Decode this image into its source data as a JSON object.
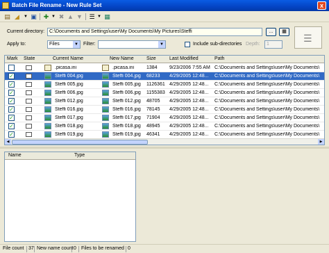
{
  "window": {
    "title": "Batch File Rename - New Rule Set",
    "close_label": "x"
  },
  "toolbar": {
    "icons": [
      "new-icon",
      "open-icon",
      "save-icon",
      "add-icon",
      "delete-icon",
      "up-icon",
      "down-icon",
      "view-icon",
      "copy-icon"
    ]
  },
  "top": {
    "dir_label": "Current directory:",
    "dir_value": "C:\\Documents and Settings\\user\\My Documents\\My Pictures\\Steffi",
    "browse_label": "...",
    "apply_label": "Apply to:",
    "apply_value": "Files",
    "filter_label": "Filter:",
    "filter_value": "",
    "subdir_label": "Include sub-directories",
    "depth_label": "Depth:",
    "depth_value": "1"
  },
  "grid": {
    "columns": [
      "Mark",
      "State",
      "Current Name",
      "New Name",
      "Size",
      "Last Modified",
      "Path"
    ],
    "rows": [
      {
        "mark": false,
        "cur": ".picasa.ini",
        "new": ".picasa.ini",
        "size": "1384",
        "mod": "9/23/2006 7:55 AM",
        "path": "C:\\Documents and Settings\\user\\My Documents\\",
        "ini": true,
        "sel": false
      },
      {
        "mark": true,
        "cur": "Steffi 004.jpg",
        "new": "Steffi 004.jpg",
        "size": "68233",
        "mod": "4/29/2005 12:48...",
        "path": "C:\\Documents and Settings\\user\\My Documents\\",
        "ini": false,
        "sel": true
      },
      {
        "mark": true,
        "cur": "Steffi 005.jpg",
        "new": "Steffi 005.jpg",
        "size": "1126361",
        "mod": "4/29/2005 12:48...",
        "path": "C:\\Documents and Settings\\user\\My Documents\\",
        "ini": false,
        "sel": false
      },
      {
        "mark": true,
        "cur": "Steffi 006.jpg",
        "new": "Steffi 006.jpg",
        "size": "1155383",
        "mod": "4/29/2005 12:48...",
        "path": "C:\\Documents and Settings\\user\\My Documents\\",
        "ini": false,
        "sel": false
      },
      {
        "mark": true,
        "cur": "Steffi 012.jpg",
        "new": "Steffi 012.jpg",
        "size": "48705",
        "mod": "4/29/2005 12:48...",
        "path": "C:\\Documents and Settings\\user\\My Documents\\",
        "ini": false,
        "sel": false
      },
      {
        "mark": true,
        "cur": "Steffi 016.jpg",
        "new": "Steffi 016.jpg",
        "size": "78145",
        "mod": "4/29/2005 12:48...",
        "path": "C:\\Documents and Settings\\user\\My Documents\\",
        "ini": false,
        "sel": false
      },
      {
        "mark": true,
        "cur": "Steffi 017.jpg",
        "new": "Steffi 017.jpg",
        "size": "71904",
        "mod": "4/29/2005 12:48...",
        "path": "C:\\Documents and Settings\\user\\My Documents\\",
        "ini": false,
        "sel": false
      },
      {
        "mark": true,
        "cur": "Steffi 018.jpg",
        "new": "Steffi 018.jpg",
        "size": "48945",
        "mod": "4/29/2005 12:48...",
        "path": "C:\\Documents and Settings\\user\\My Documents\\",
        "ini": false,
        "sel": false
      },
      {
        "mark": true,
        "cur": "Steffi 019.jpg",
        "new": "Steffi 019.jpg",
        "size": "46341",
        "mod": "4/29/2005 12:48...",
        "path": "C:\\Documents and Settings\\user\\My Documents\\",
        "ini": false,
        "sel": false
      }
    ]
  },
  "lower": {
    "columns": [
      "Name",
      "Type"
    ]
  },
  "status": {
    "file_count_label": "File count",
    "file_count": "37",
    "new_name_label": "New name count",
    "new_name": "0",
    "rename_label": "Files to be renamed",
    "rename": "0"
  },
  "colors": {
    "title": "#0a5ce4",
    "selection": "#316ac5"
  }
}
